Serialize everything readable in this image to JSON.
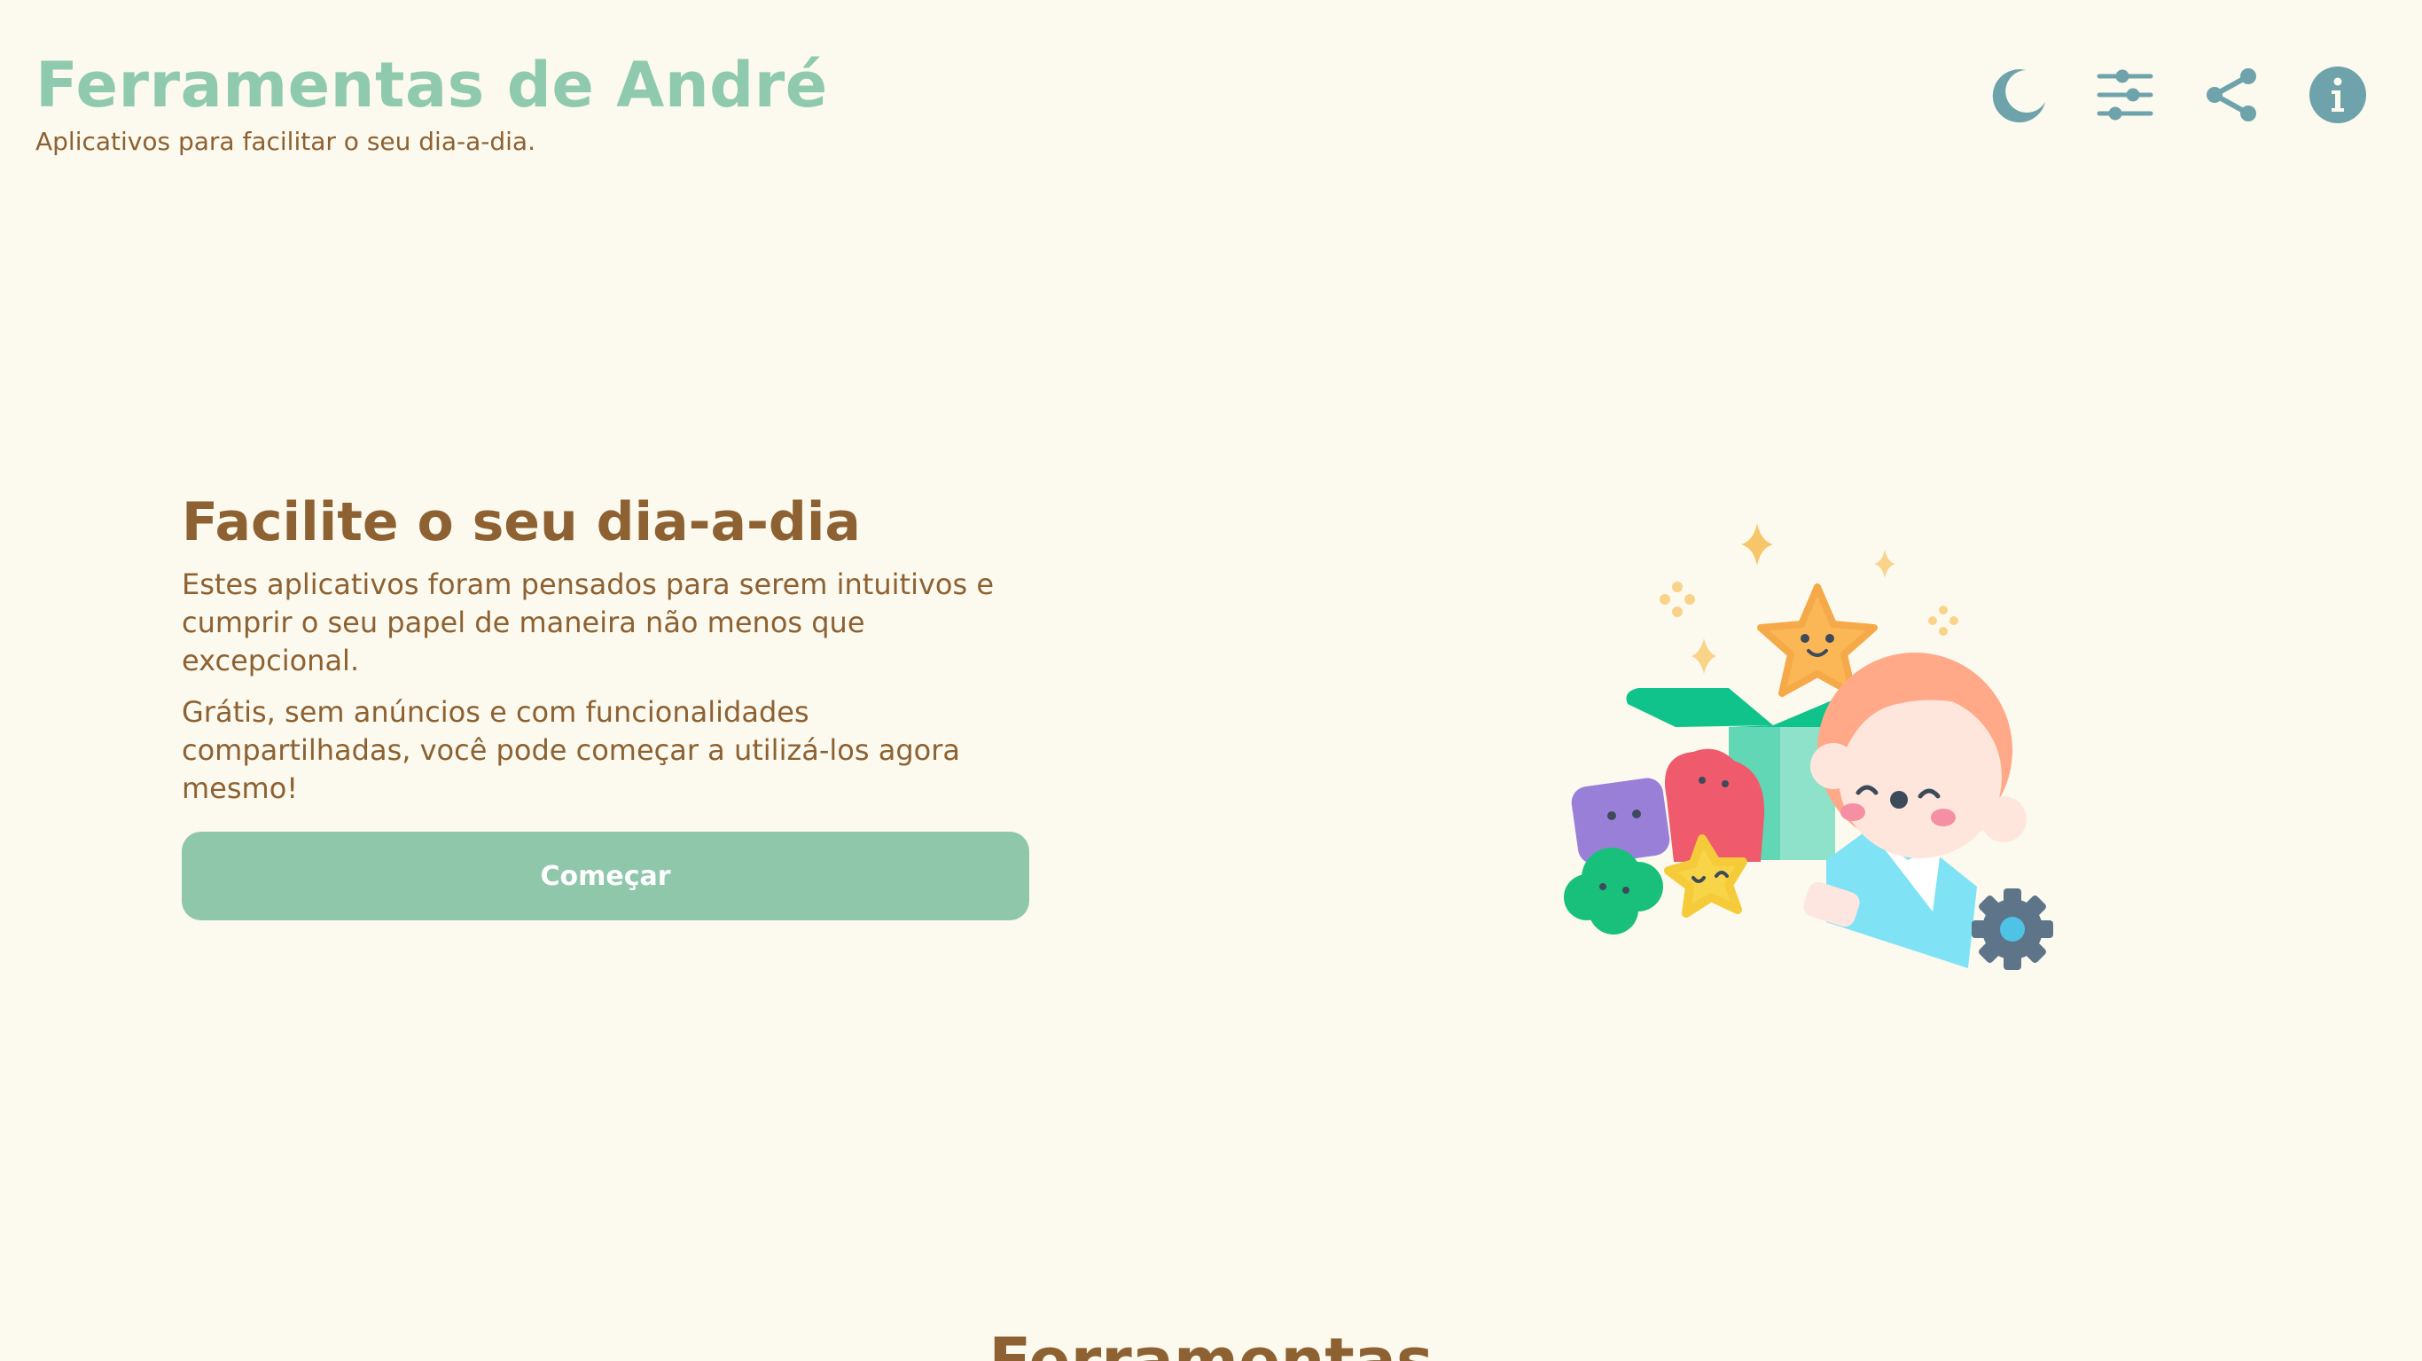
{
  "header": {
    "title": "Ferramentas de André",
    "subtitle": "Aplicativos para facilitar o seu dia-a-dia."
  },
  "toolbar": {
    "items": [
      {
        "icon": "moon-icon",
        "action": "theme"
      },
      {
        "icon": "sliders-icon",
        "action": "settings"
      },
      {
        "icon": "share-icon",
        "action": "share"
      },
      {
        "icon": "info-icon",
        "action": "info"
      }
    ]
  },
  "hero": {
    "title": "Facilite o seu dia-a-dia",
    "paragraph1": "Estes aplicativos foram pensados para serem intuitivos e cumprir o seu papel de maneira não menos que excepcional.",
    "paragraph2": "Grátis, sem anúncios e com funcionalidades compartilhadas, você pode começar a utilizá-los agora mesmo!",
    "cta_label": "Começar"
  },
  "tools_section": {
    "title": "Ferramentas"
  },
  "colors": {
    "background": "#fcfaee",
    "accent": "#8fcaae",
    "text": "#8d6132",
    "icons": "#6fa3ab"
  }
}
